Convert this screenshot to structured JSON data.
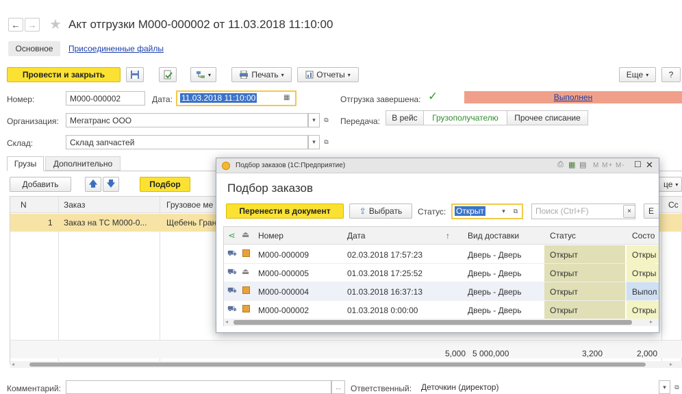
{
  "nav": {
    "back": "←",
    "forward": "→",
    "star": "★"
  },
  "title": "Акт отгрузки М000-000002 от 11.03.2018 11:10:00",
  "sections": {
    "main": "Основное",
    "files": "Присоединенные файлы"
  },
  "toolbar": {
    "post_close": "Провести и закрыть",
    "print": "Печать",
    "reports": "Отчеты",
    "more": "Еще",
    "help": "?"
  },
  "form": {
    "number_label": "Номер:",
    "number_value": "М000-000002",
    "date_label": "Дата:",
    "date_value": "11.03.2018 11:10:00",
    "shipped_label": "Отгрузка завершена:",
    "status_badge": "Выполнен",
    "org_label": "Организация:",
    "org_value": "Мегатранс ООО",
    "transfer_label": "Передача:",
    "transfer_options": [
      "В рейс",
      "Грузополучателю",
      "Прочее списание"
    ],
    "warehouse_label": "Склад:",
    "warehouse_value": "Склад запчастей",
    "comment_label": "Комментарий:",
    "comment_btn": "...",
    "responsible_label": "Ответственный:",
    "responsible_value": "Деточкин (директор)"
  },
  "tabs": [
    "Грузы",
    "Дополнительно"
  ],
  "grid": {
    "add_btn": "Добавить",
    "pick_btn": "Подбор",
    "more_partial": "це",
    "col_partial": "Сс",
    "columns": [
      "N",
      "Заказ",
      "Грузовое ме"
    ],
    "rows": [
      {
        "n": "1",
        "order": "Заказ на ТС М000-0...",
        "cargo": "Щебень Гран"
      }
    ],
    "totals": [
      "5,000",
      "5 000,000",
      "3,200",
      "2,000"
    ]
  },
  "dialog": {
    "window_title": "Подбор заказов (1С:Предприятие)",
    "window_buttons": "M M+ M-",
    "heading": "Подбор заказов",
    "transfer_btn": "Перенести в документ",
    "select_btn": "Выбрать",
    "status_label": "Статус:",
    "status_value": "Открыт",
    "search_placeholder": "Поиск (Ctrl+F)",
    "search_partial": "Е",
    "columns": [
      "Номер",
      "Дата",
      "Вид доставки",
      "Статус",
      "Состо"
    ],
    "sort_arrow": "↑",
    "rows": [
      {
        "number": "М000-000009",
        "date": "02.03.2018 17:57:23",
        "delivery": "Дверь - Дверь",
        "status": "Открыт",
        "state": "Откры",
        "selected": false
      },
      {
        "number": "М000-000005",
        "date": "01.03.2018 17:25:52",
        "delivery": "Дверь - Дверь",
        "status": "Открыт",
        "state": "Откры",
        "selected": false
      },
      {
        "number": "М000-000004",
        "date": "01.03.2018 16:37:13",
        "delivery": "Дверь - Дверь",
        "status": "Открыт",
        "state": "Выпол",
        "selected": true
      },
      {
        "number": "М000-000002",
        "date": "01.03.2018 0:00:00",
        "delivery": "Дверь - Дверь",
        "status": "Открыт",
        "state": "Откры",
        "selected": false
      }
    ]
  },
  "colors": {
    "accent_yellow": "#fbe232",
    "done_badge": "#f0a08a",
    "status_cell": "#e0dfb6",
    "selected_row": "#f7e3a6"
  }
}
